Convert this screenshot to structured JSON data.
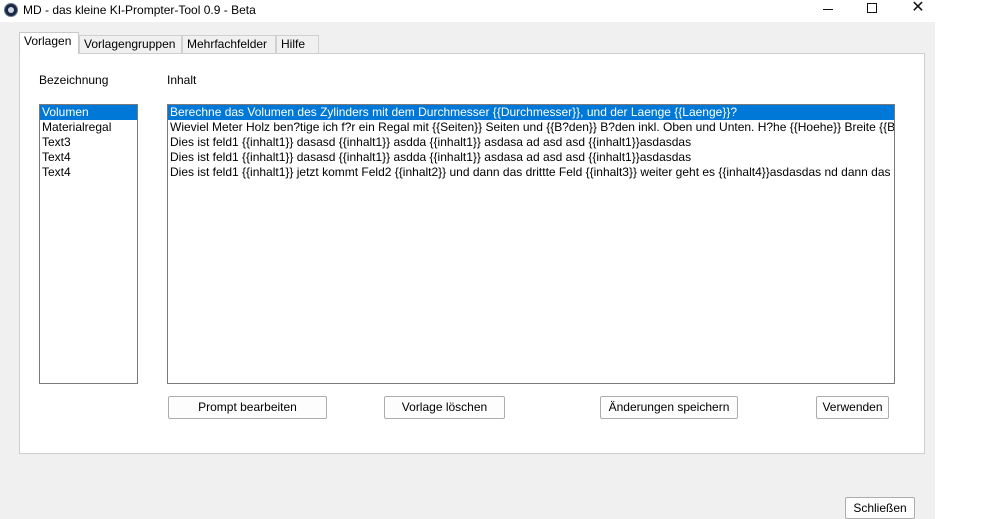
{
  "window": {
    "title": "MD - das kleine KI-Prompter-Tool  0.9 - Beta",
    "icon": "app-icon"
  },
  "tabs": [
    {
      "label": "Vorlagen",
      "active": true
    },
    {
      "label": "Vorlagengruppen",
      "active": false
    },
    {
      "label": "Mehrfachfelder",
      "active": false
    },
    {
      "label": "Hilfe",
      "active": false
    }
  ],
  "panel": {
    "bezeichnung_label": "Bezeichnung",
    "inhalt_label": "Inhalt",
    "names": [
      "Volumen",
      "Materialregal",
      "Text3",
      "Text4",
      "Text4"
    ],
    "contents": [
      "Berechne das Volumen des Zylinders mit dem Durchmesser {{Durchmesser}}, und der Laenge {{Laenge}}?",
      "Wieviel Meter Holz ben?tige ich f?r ein Regal mit {{Seiten}} Seiten und {{B?den}} B?den inkl. Oben und Unten. H?he {{Hoehe}} Breite {{Breit",
      "Dies ist feld1 {{inhalt1}} dasasd {{inhalt1}} asdda {{inhalt1}} asdasa ad asd asd {{inhalt1}}asdasdas",
      "Dies ist feld1 {{inhalt1}} dasasd {{inhalt1}} asdda {{inhalt1}} asdasa ad asd asd {{inhalt1}}asdasdas",
      "Dies ist feld1 {{inhalt1}} jetzt kommt Feld2 {{inhalt2}} und dann das drittte Feld {{inhalt3}} weiter geht es {{inhalt4}}asdasdas nd dann das f?"
    ],
    "selected_index": 0,
    "buttons": {
      "prompt_bearbeiten": "Prompt bearbeiten",
      "vorlage_loeschen": "Vorlage löschen",
      "aenderungen_speichern": "Änderungen speichern",
      "verwenden": "Verwenden"
    }
  },
  "footer": {
    "close_label": "Schließen"
  },
  "colors": {
    "selection": "#0078d7",
    "window_bg": "#f0f0f0",
    "panel_bg": "#ffffff"
  }
}
